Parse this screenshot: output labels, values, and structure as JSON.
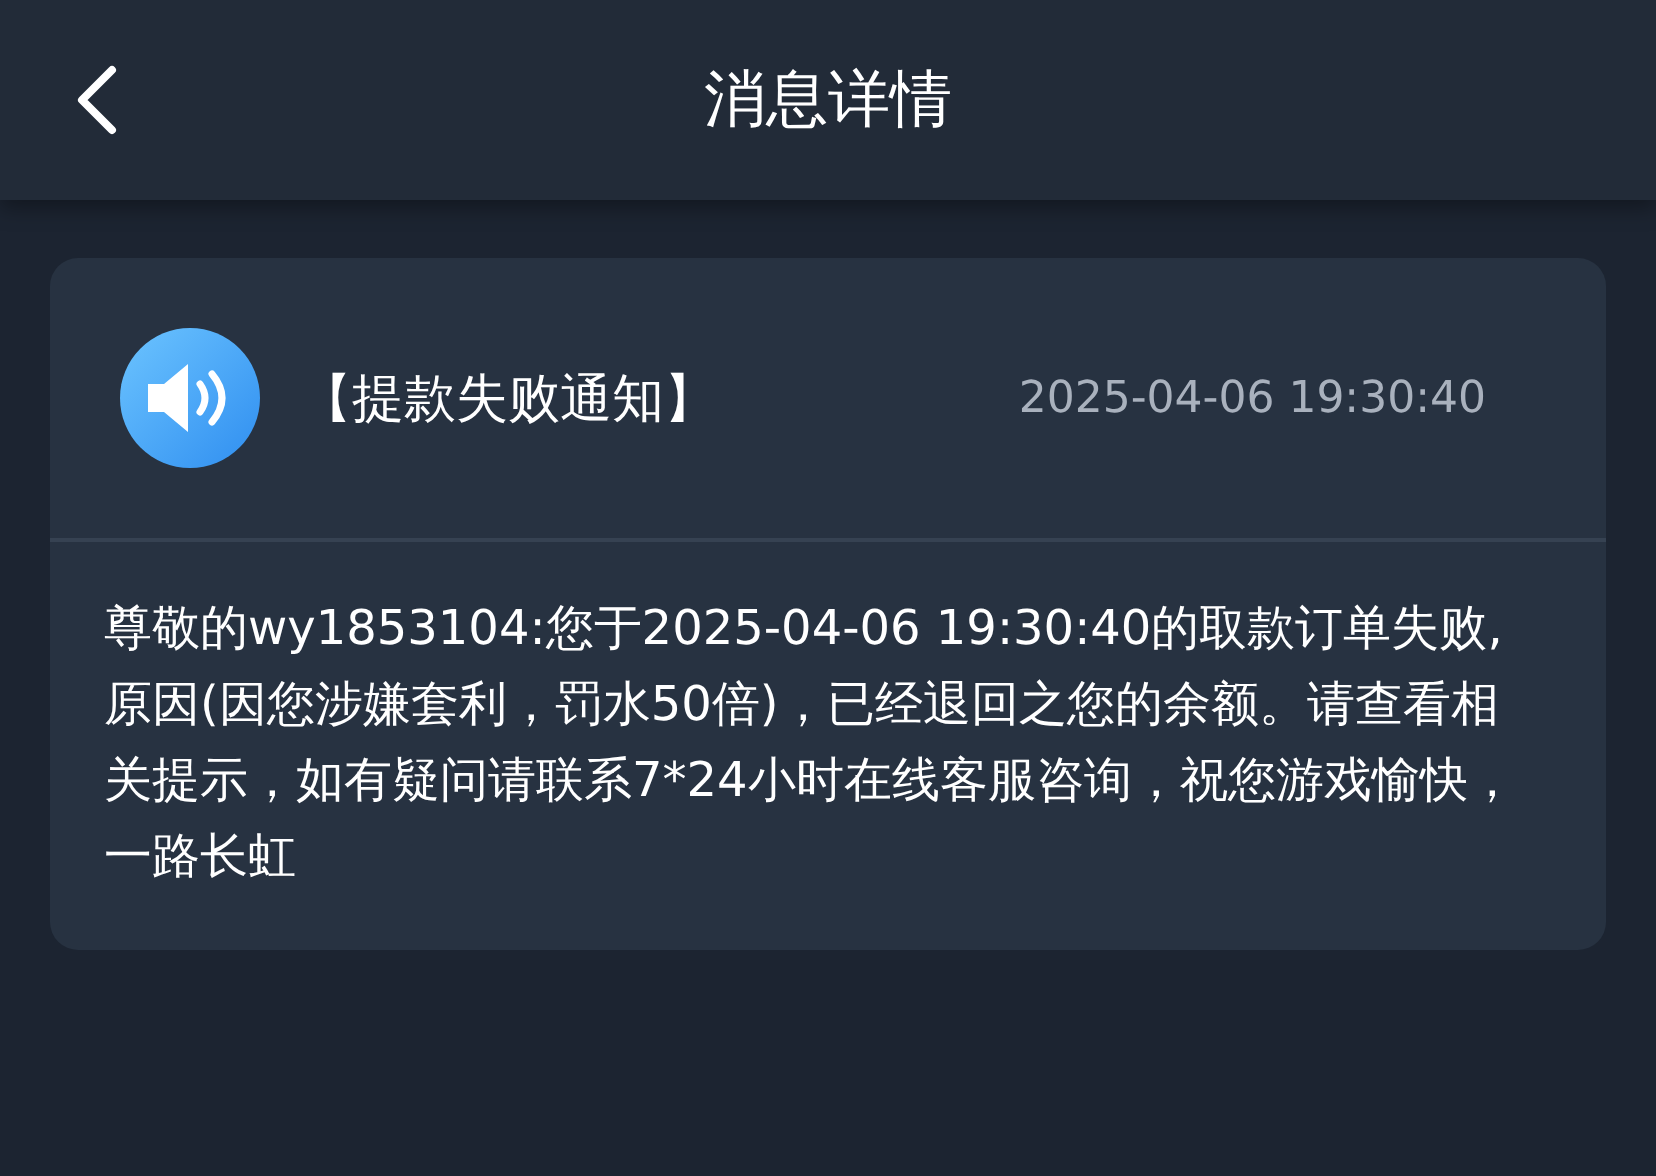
{
  "header": {
    "title": "消息详情"
  },
  "message": {
    "title": "【提款失败通知】",
    "time": "2025-04-06 19:30:40",
    "body": "尊敬的wy1853104:您于2025-04-06 19:30:40的取款订单失败,原因(因您涉嫌套利，罚水50倍)，已经退回之您的余额。请查看相关提示，如有疑问请联系7*24小时在线客服咨询，祝您游戏愉快，一路长虹"
  }
}
